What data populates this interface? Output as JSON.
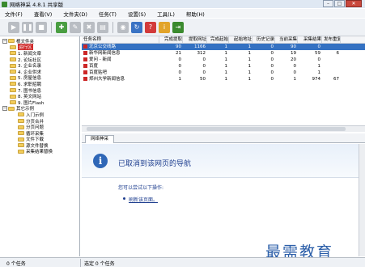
{
  "window": {
    "title": "网络神采 4.8.1 共享版"
  },
  "menu": [
    "文件(F)",
    "查看(V)",
    "文件夹(D)",
    "任务(T)",
    "设置(S)",
    "工具(L)",
    "帮助(H)"
  ],
  "tree": {
    "root": "根文件夹",
    "items": [
      "运行区",
      "1. 新闻文章",
      "2. 论坛社区",
      "3. 企业名录",
      "4. 企业供求",
      "5. 房屋信息",
      "6. 求职招聘",
      "7. 图书信息",
      "8. 英文网站",
      "9. 图片Flash"
    ],
    "other": "其它示例",
    "sub": [
      "入门示例",
      "分页合并",
      "分页问题",
      "循环采集",
      "文件下载",
      "源文件替换",
      "采集结果替换"
    ]
  },
  "task_table": {
    "columns": [
      "任务名称",
      "完成提取",
      "提取网址",
      "完成起始",
      "起始地址",
      "历史记录",
      "当前采集",
      "采集结果",
      "发布重复"
    ],
    "rows": [
      [
        "北京公交线路",
        "90",
        "1166",
        "1",
        "1",
        "0",
        "90",
        "0",
        ""
      ],
      [
        "新华网新闻信息",
        "21",
        "312",
        "1",
        "1",
        "0",
        "19",
        "59",
        "6"
      ],
      [
        "爱问 - 新闻",
        "0",
        "0",
        "1",
        "1",
        "0",
        "20",
        "0",
        ""
      ],
      [
        "百度",
        "0",
        "0",
        "1",
        "1",
        "0",
        "0",
        "1",
        ""
      ],
      [
        "百度贴吧",
        "0",
        "0",
        "1",
        "1",
        "0",
        "0",
        "1",
        ""
      ],
      [
        "郑州大学新闻信息",
        "1",
        "50",
        "1",
        "1",
        "0",
        "1",
        "974",
        "67"
      ]
    ]
  },
  "browser": {
    "tab": "网络神采",
    "error_title": "已取消到该网页的导航",
    "try_text": "您可以尝试以下操作:",
    "refresh_link": "刷新该页面。"
  },
  "status": {
    "left": "0 个任务",
    "right": "选定 0 个任务"
  },
  "watermark": "最需教育",
  "colors": {
    "accent": "#cf2b2b",
    "selection": "#3471c2",
    "link": "#1f3f8f"
  }
}
